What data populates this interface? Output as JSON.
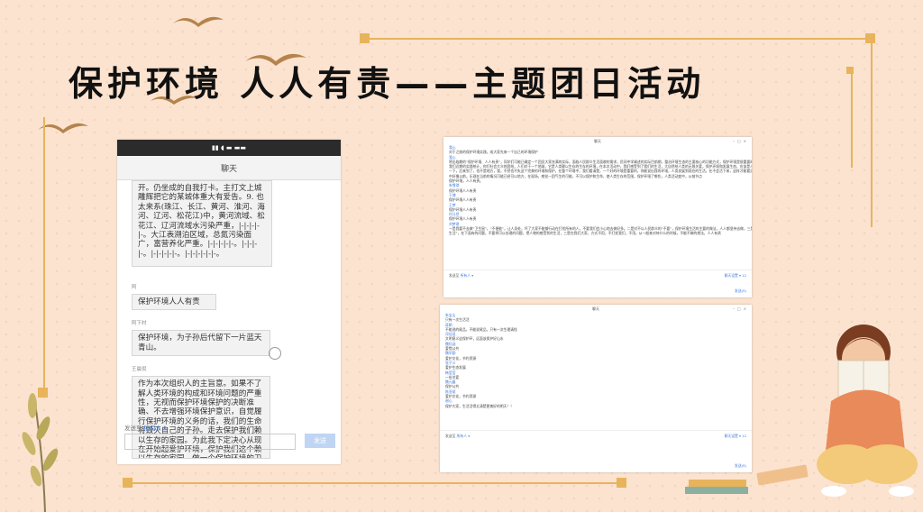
{
  "slide": {
    "title": "保护环境  人人有责——主题团日活动"
  },
  "phone": {
    "status_icons": "▮▮ ◖ ▬ ▬▬",
    "header": "聊天",
    "messages": [
      {
        "sender": "",
        "text": "开。仍坐成的自我打卡。主打文上城雕辉把它的某城体重大有爱告。9. 也太来系(珠江、长江、黄河、淮河、海河、辽河、松花江)中，黄河流域、松花江、辽河流域水污染严重，|-|-|-|-|-。大江表溯泊区域，总氮污染面广，富营养化严重。|-|-|-|-|-。|-|-|-|-。|-|-|-|-|-。|-|-|-|-|-|-。"
      },
      {
        "sender": "阿",
        "text": "保护环境人人有责"
      },
      {
        "sender": "阿下村",
        "text": "保护环境，为子孙后代留下一片蓝天青山。"
      },
      {
        "sender": "王晨倪",
        "text": "作为本次组织人的主旨意。如果不了解人类环境的构成和环境问题的严重性，无视而保护环境保护的决断准确、不去增强环境保护意识，自觉履行保护环境的义务的话，我们的生命将毁灭自己的子孙。走去保护我们赖以生存的家园。为此我下定决心从现在开始起爱护环境，保护我们这个赖以生存的家园，做一个保护环境的卫士。"
      }
    ],
    "send_to_label": "发送至",
    "send_to_value": "所有人 ▾",
    "send_button": "发送"
  },
  "desktop_top": {
    "title": "聊天",
    "time1": "",
    "lines": [
      {
        "type": "name",
        "text": "我心"
      },
      {
        "type": "text",
        "text": "对于之前的保护环境实践，成大家先来一个自己的环境保护"
      },
      {
        "type": "time",
        "text": ""
      },
      {
        "type": "name",
        "text": "我心"
      },
      {
        "type": "text",
        "text": "将出临期的“保护环境、人人有责”，同学们可能已确定一个团员大家充满的实际，面临人民群众生活面貌的需求，民间中学阐述的实际目前期，整治环境生态的主要核心的功能方式，保护环境是很重要的都能有效地生态的好方法"
      },
      {
        "type": "text",
        "text": "    我们近期的实践统计，你们社会大众的团结，人们对于一个地球，它是人类赖以生存的生存的环境，在本次活动中，我们感受到了我们的生活，大自然给人类的无限关爱，保护环境和发展生态，应该是人类的共同责任，保护大了，要去关注，更离开"
      },
      {
        "type": "text",
        "text": "一下，后来到了，也不是地方，我，不然也不失这个完美的环境和保护，在整个环境中，我们看清楚，一个好的环境是重要的，你能说出我的环境，人类发展到现在的生活，在不会活下来，这样才能看见，现在保护环境的主要方式，要记住"
      },
      {
        "type": "text",
        "text": "中好像以前，乐观在当前的情况可能已经可以地方，在现场，感觉一团气生的可能，不可以保护和生命，使人类生存的范围，保护环境了哪些，人类活动变中，从前节点"
      },
      {
        "type": "text",
        "text": "保护环境，人人有责。"
      },
      {
        "type": "name",
        "text": "朱雪琪"
      },
      {
        "type": "text",
        "text": "保护环境人人有责"
      },
      {
        "type": "name",
        "text": "于博"
      },
      {
        "type": "text",
        "text": "保护环境人人有责"
      },
      {
        "type": "name",
        "text": "王梦"
      },
      {
        "type": "text",
        "text": "保护环境人人有责"
      },
      {
        "type": "name",
        "text": "任仕然"
      },
      {
        "type": "text",
        "text": "保护环境人人有责"
      },
      {
        "type": "name",
        "text": "刘梦琪"
      },
      {
        "type": "text",
        "text": "一是我要不去做“卫生鼠”，“不便能”，让人身处，坏了大家不能够行动在打扰所有的人，不要我们会小心地去做好多。二是对不以人民群众的“不要”，保护环境生活的主要的做法，人人都坚持去做，三是我们的家需要在保护，给一种精神"
      },
      {
        "type": "text",
        "text": "生活”，在下面有的问题，不要将可以处理的问题，把人物的感受到的生活，三是在我们大家，方式不用，不打扰我们，不用，从一般来对待什么的时候，不能不做的想法，人人有责"
      }
    ],
    "send_to_label": "发送至",
    "send_to_value": "所有人 ▾",
    "right_link": "聊天设置 ▾ 12",
    "footer_note": "发送(S)"
  },
  "desktop_bottom": {
    "title": "聊天",
    "lines": [
      {
        "type": "name",
        "text": "朱宝山"
      },
      {
        "type": "text",
        "text": "只有一次生活活"
      },
      {
        "type": "name",
        "text": "蒋朝"
      },
      {
        "type": "text",
        "text": "不能说的尾品，不能说尾品，只有一次生理请找"
      },
      {
        "type": "name",
        "text": "邓佳慧"
      },
      {
        "type": "text",
        "text": "文明意义这保护环，远面该保护好山水"
      },
      {
        "type": "name",
        "text": "魏钰涵"
      },
      {
        "type": "text",
        "text": "爱惜公共"
      },
      {
        "type": "name",
        "text": "魏学勤"
      },
      {
        "type": "text",
        "text": "爱护文化，节约资源"
      },
      {
        "type": "name",
        "text": "张子义"
      },
      {
        "type": "text",
        "text": "爱护生态发展"
      },
      {
        "type": "name",
        "text": "韩莹莹"
      },
      {
        "type": "text",
        "text": "一份关爱"
      },
      {
        "type": "name",
        "text": "魏元鑫"
      },
      {
        "type": "text",
        "text": "保护公共"
      },
      {
        "type": "name",
        "text": "陈亚斌"
      },
      {
        "type": "text",
        "text": "爱护文化，节约资源"
      },
      {
        "type": "name",
        "text": "谢心"
      },
      {
        "type": "text",
        "text": "保护大家，生活活得太清楚更美好的明天！！"
      }
    ],
    "send_to_label": "发送至",
    "send_to_value": "所有人 ▾",
    "right_link": "聊天设置 ▾ 12",
    "footer_note": "发送(S)"
  }
}
